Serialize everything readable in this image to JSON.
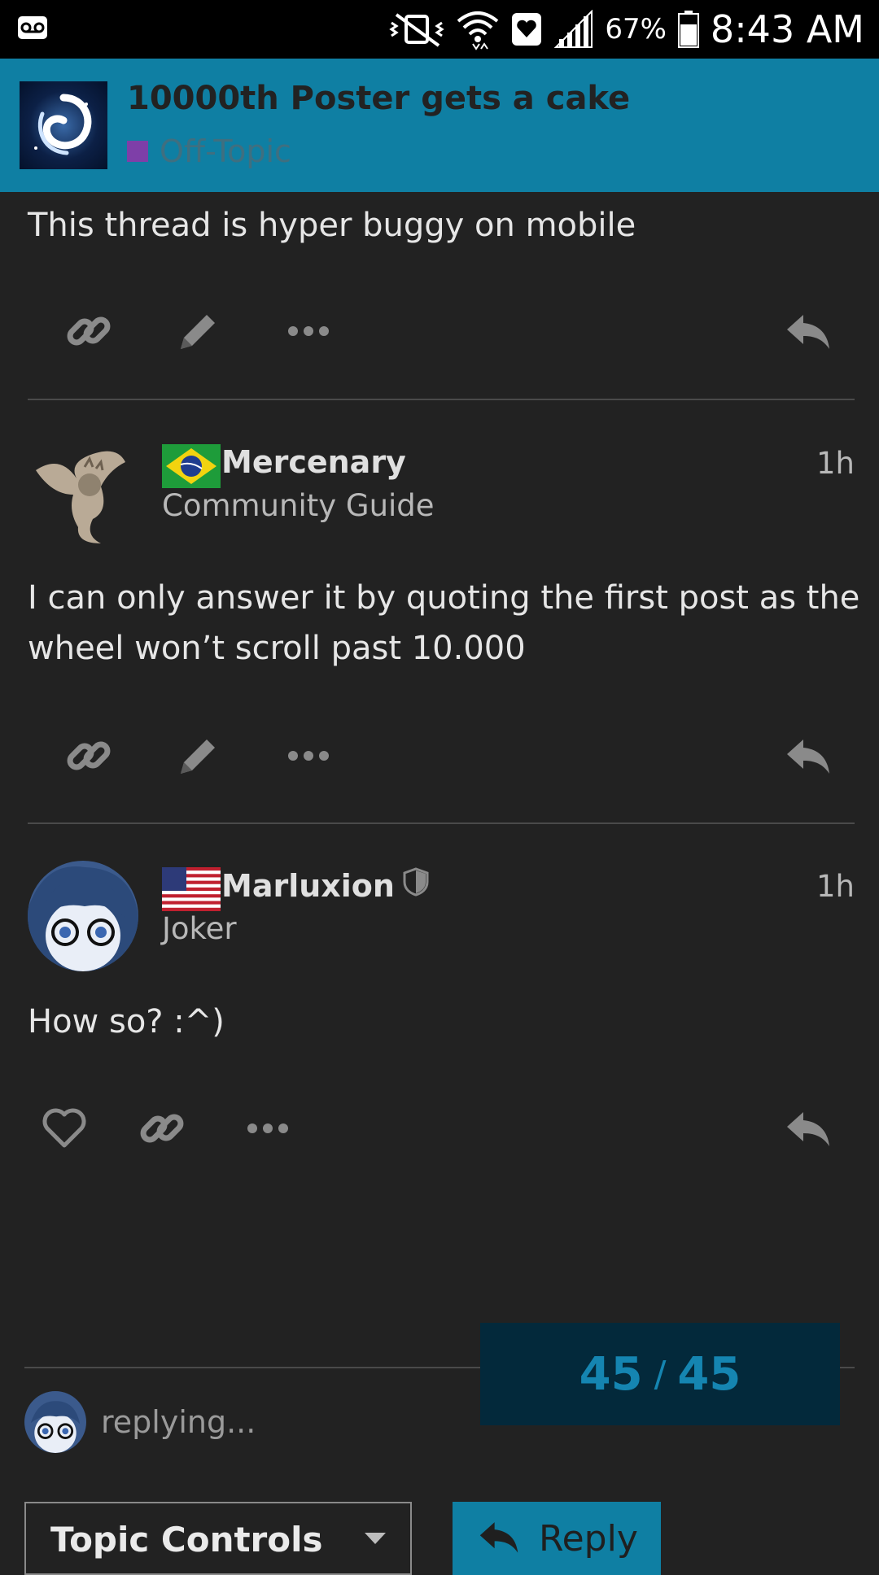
{
  "status_bar": {
    "battery_percent": "67%",
    "time": "8:43 AM"
  },
  "topic": {
    "title": "10000th Poster gets a cake",
    "category": "Off-Topic",
    "category_color": "#7e3fa8",
    "header_color": "#0f7fa3"
  },
  "posts": [
    {
      "text": "This thread is hyper buggy on mobile",
      "actions": [
        "link-icon",
        "pencil-icon",
        "more-icon",
        "reply-icon"
      ]
    },
    {
      "username": "Mercenary",
      "user_title": "Community Guide",
      "time": "1h",
      "flag": "brazil-flag",
      "text_line1": "I can only answer it by quoting the first post as the",
      "text_line2": "wheel won’t scroll past 10.000",
      "actions": [
        "link-icon",
        "pencil-icon",
        "more-icon",
        "reply-icon"
      ]
    },
    {
      "username": "Marluxion",
      "user_title": "Joker",
      "time": "1h",
      "flag": "usa-flag",
      "badge": "shield-icon",
      "text": "How so? :^)",
      "actions": [
        "heart-icon",
        "link-icon",
        "more-icon",
        "reply-icon"
      ]
    }
  ],
  "progress": {
    "current": "45",
    "separator": "/",
    "total": "45"
  },
  "composer": {
    "status": "replying..."
  },
  "footer": {
    "topic_controls_label": "Topic Controls",
    "reply_label": "Reply"
  }
}
